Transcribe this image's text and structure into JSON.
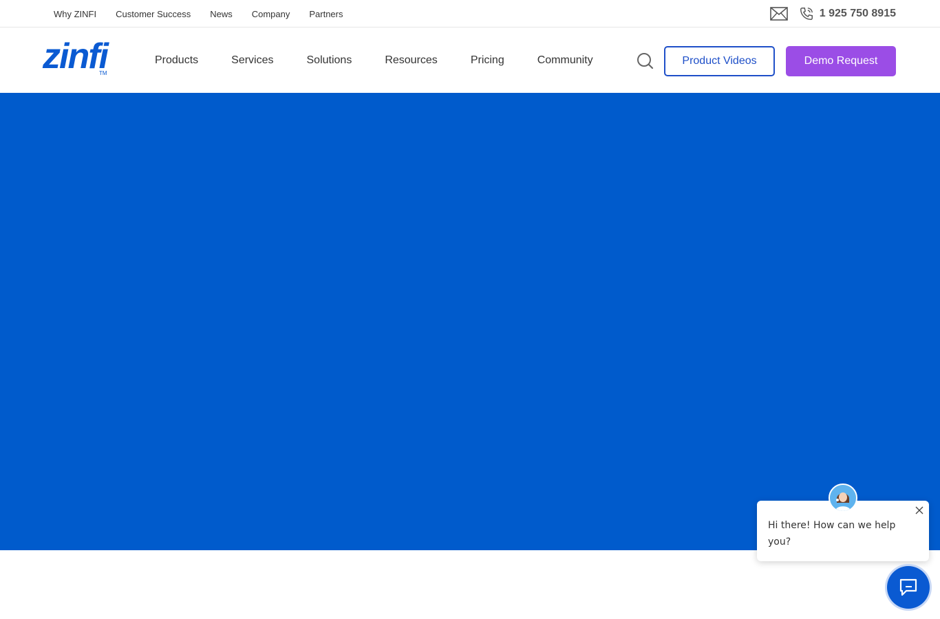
{
  "topbar": {
    "links": [
      "Why ZINFI",
      "Customer Success",
      "News",
      "Company",
      "Partners"
    ],
    "phone": "1 925 750 8915",
    "icons": {
      "mail": "mail-icon",
      "phone": "phone-icon"
    }
  },
  "header": {
    "logo_text": "zinfi",
    "logo_tm": "TM",
    "menu": [
      "Products",
      "Services",
      "Solutions",
      "Resources",
      "Pricing",
      "Community"
    ],
    "product_videos_label": "Product Videos",
    "demo_request_label": "Demo Request",
    "colors": {
      "brand": "#0a5ad2",
      "demo_button": "#9b4de6",
      "hero": "#005bcc"
    }
  },
  "chat": {
    "greeting": "Hi there! How can we help you?",
    "icons": {
      "close": "close-icon",
      "launcher": "chat-icon"
    }
  }
}
